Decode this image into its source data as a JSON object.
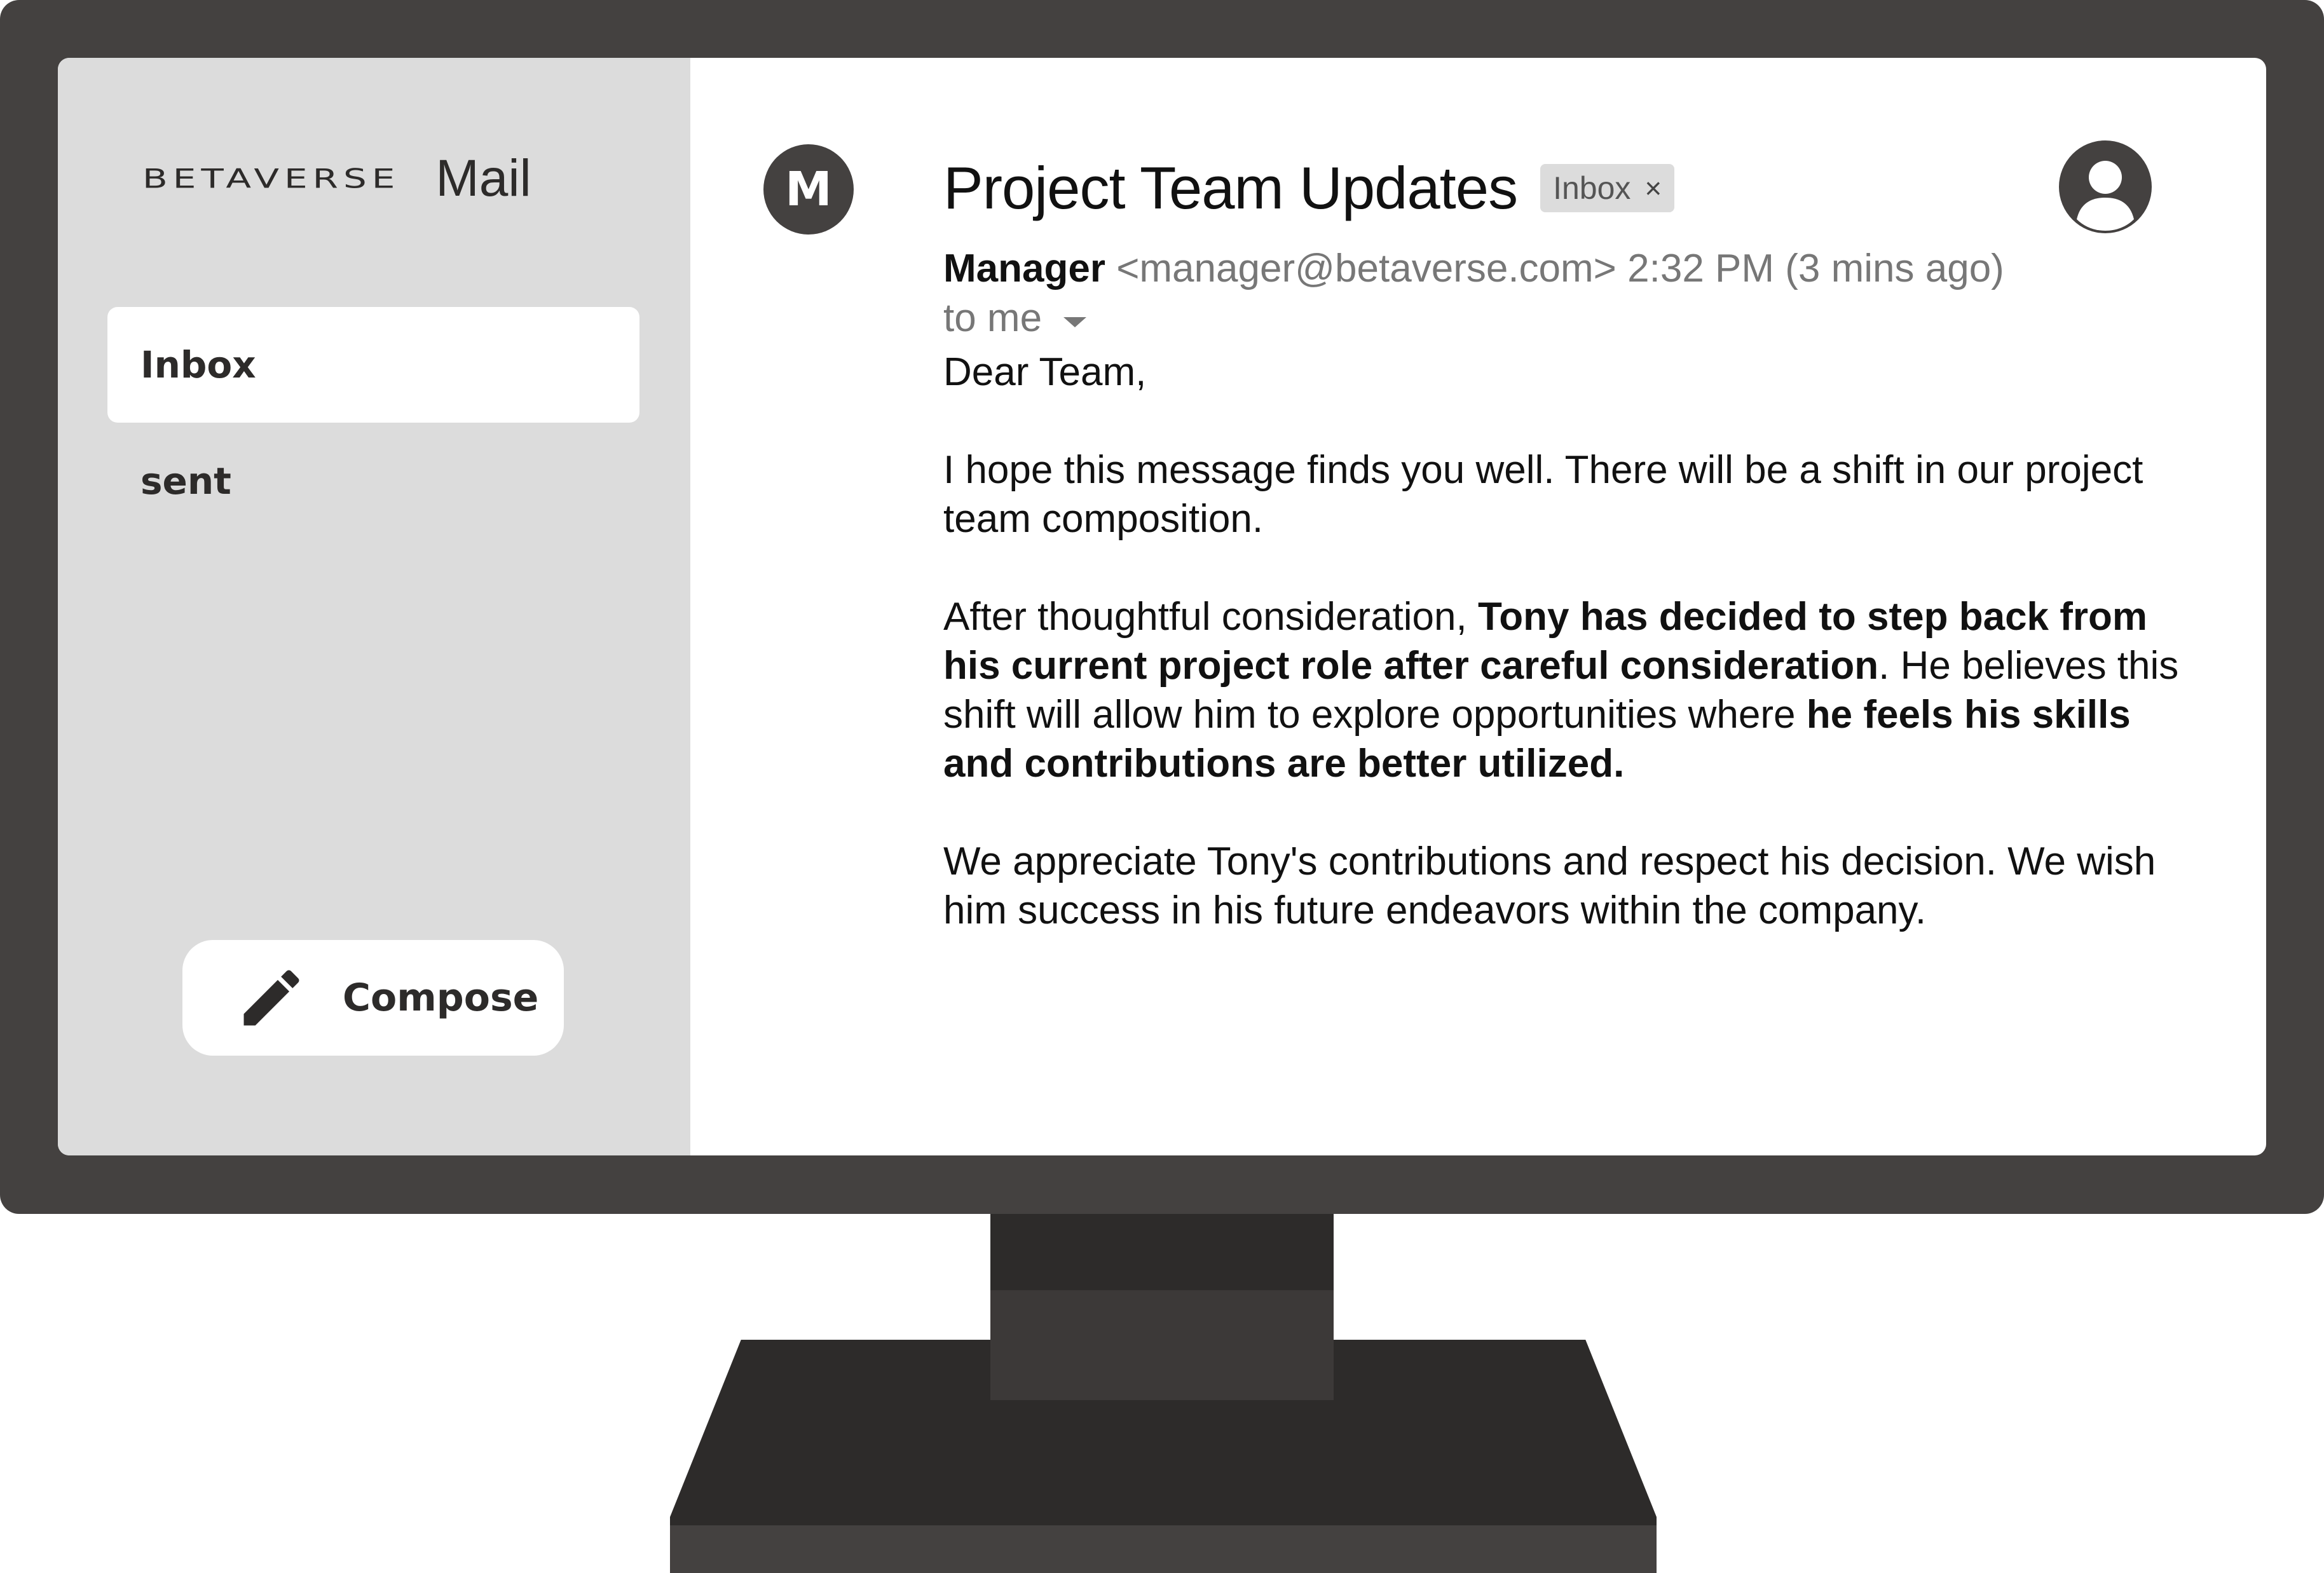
{
  "sidebar": {
    "brand_name": "BETAVERSE",
    "brand_suffix": "Mail",
    "items": [
      {
        "label": "Inbox",
        "active": true
      },
      {
        "label": "sent",
        "active": false
      }
    ],
    "compose_label": "Compose",
    "compose_icon": "pencil-icon"
  },
  "email": {
    "sender_initial": "M",
    "subject": "Project Team Updates",
    "label_chip": "Inbox",
    "label_chip_close": "×",
    "sender_name": "Manager",
    "sender_email": "<manager@betaverse.com>",
    "time": "2:32 PM (3 mins ago)",
    "recipient": "to me",
    "body": {
      "greeting": "Dear Team,",
      "para1": "I hope this message finds you well. There will be a shift in our project team composition.",
      "para2_intro": "After thoughtful consideration, ",
      "para2_bold1": "Tony has decided to step back from his current project role after careful consideration",
      "para2_mid": ". He believes this shift will allow him to explore opportunities where ",
      "para2_bold2": "he feels his skills and contributions are better utilized.",
      "para3": "We appreciate Tony's contributions and respect his decision. We wish him success in his future endeavors within the company."
    }
  },
  "colors": {
    "bezel": "#444140",
    "sidebar_bg": "#dcdcdc",
    "chip_bg": "#dcdcdc",
    "text_dark": "#111111",
    "text_muted": "#777777"
  }
}
